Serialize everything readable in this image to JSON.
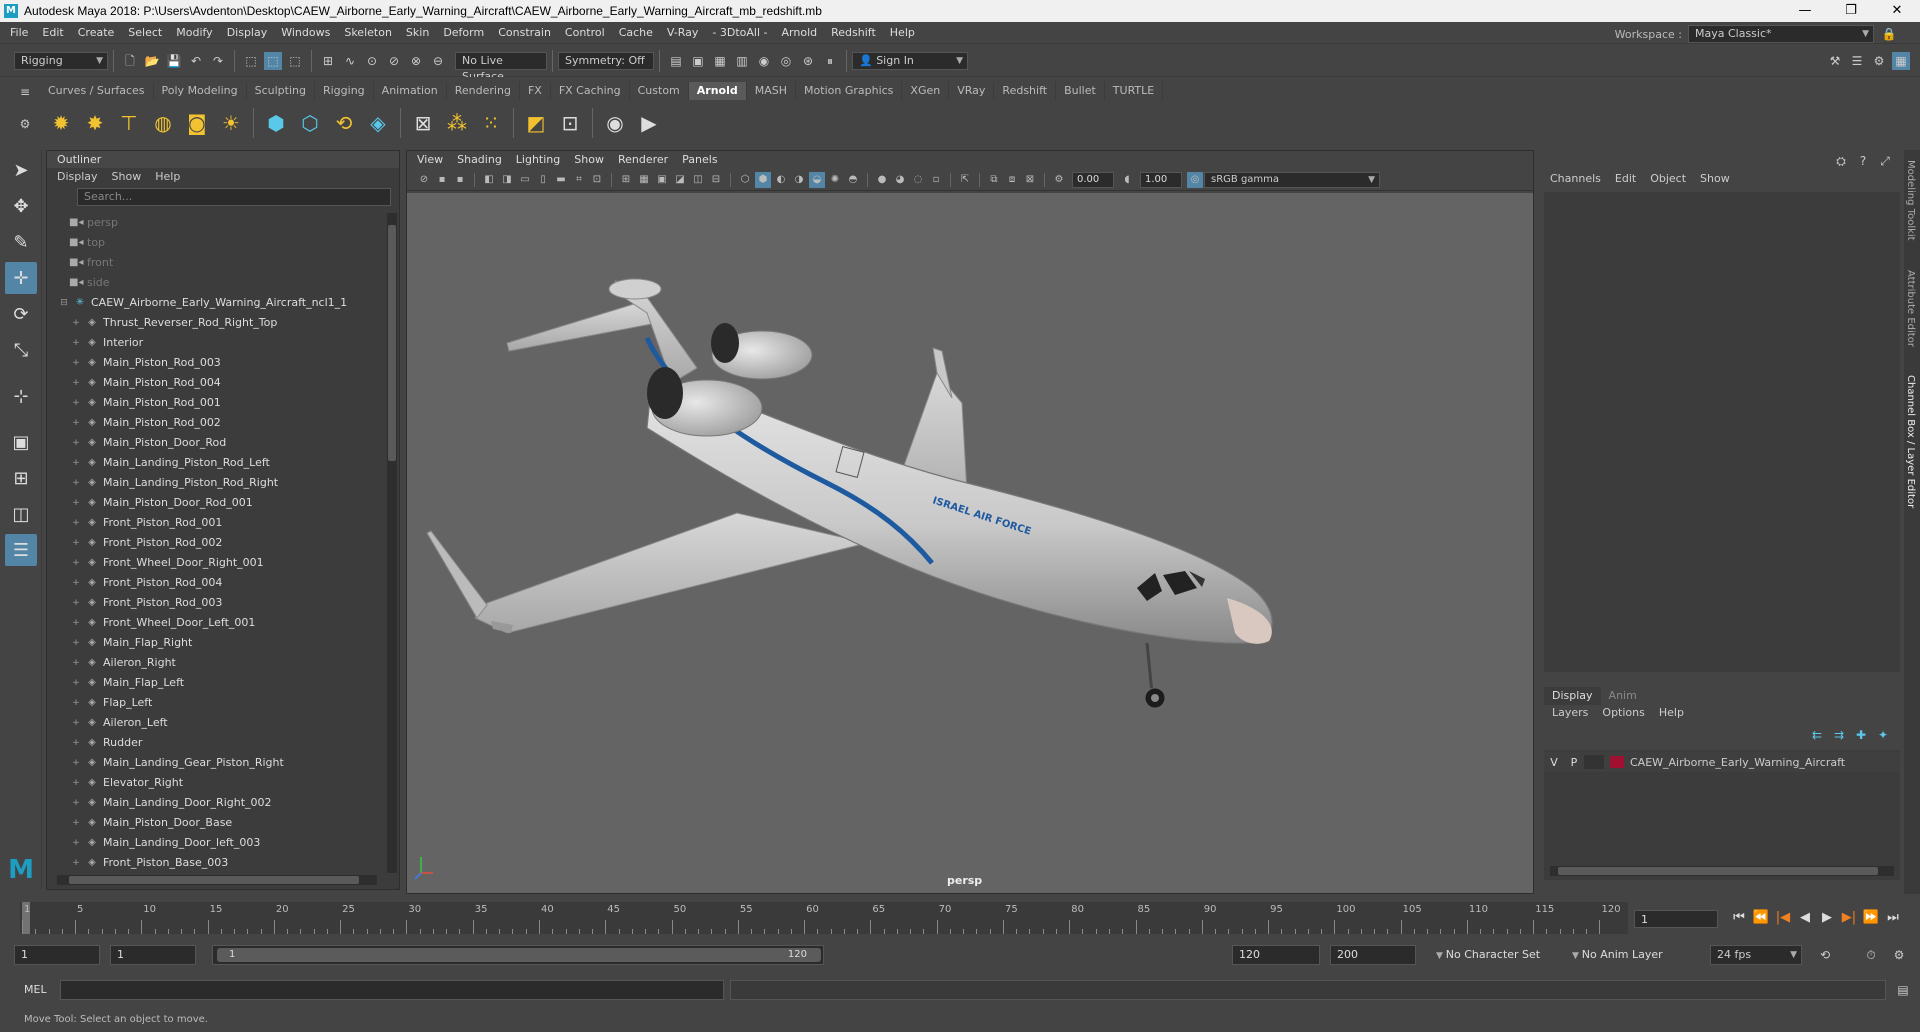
{
  "window": {
    "title": "Autodesk Maya 2018: P:\\Users\\Avdenton\\Desktop\\CAEW_Airborne_Early_Warning_Aircraft\\CAEW_Airborne_Early_Warning_Aircraft_mb_redshift.mb",
    "app_icon": "M",
    "minimize": "—",
    "maximize": "❐",
    "close": "✕"
  },
  "menubar": {
    "items": [
      "File",
      "Edit",
      "Create",
      "Select",
      "Modify",
      "Display",
      "Windows",
      "Skeleton",
      "Skin",
      "Deform",
      "Constrain",
      "Control",
      "Cache",
      "V-Ray",
      "- 3DtoAll -",
      "Arnold",
      "Redshift",
      "Help"
    ],
    "workspace_label": "Workspace :",
    "workspace_value": "Maya Classic*"
  },
  "statusline": {
    "mode": "Rigging",
    "live_surface": "No Live Surface",
    "symmetry": "Symmetry: Off",
    "sign_in": "Sign In"
  },
  "shelf": {
    "tabs": [
      "Curves / Surfaces",
      "Poly Modeling",
      "Sculpting",
      "Rigging",
      "Animation",
      "Rendering",
      "FX",
      "FX Caching",
      "Custom",
      "Arnold",
      "MASH",
      "Motion Graphics",
      "XGen",
      "VRay",
      "Redshift",
      "Bullet",
      "TURTLE"
    ],
    "active_tab": "Arnold"
  },
  "outliner": {
    "title": "Outliner",
    "menus": [
      "Display",
      "Show",
      "Help"
    ],
    "search_placeholder": "Search...",
    "cameras": [
      "persp",
      "top",
      "front",
      "side"
    ],
    "root": "CAEW_Airborne_Early_Warning_Aircraft_ncl1_1",
    "items": [
      "Thrust_Reverser_Rod_Right_Top",
      "Interior",
      "Main_Piston_Rod_003",
      "Main_Piston_Rod_004",
      "Main_Piston_Rod_001",
      "Main_Piston_Rod_002",
      "Main_Piston_Door_Rod",
      "Main_Landing_Piston_Rod_Left",
      "Main_Landing_Piston_Rod_Right",
      "Main_Piston_Door_Rod_001",
      "Front_Piston_Rod_001",
      "Front_Piston_Rod_002",
      "Front_Wheel_Door_Right_001",
      "Front_Piston_Rod_004",
      "Front_Piston_Rod_003",
      "Front_Wheel_Door_Left_001",
      "Main_Flap_Right",
      "Aileron_Right",
      "Main_Flap_Left",
      "Flap_Left",
      "Aileron_Left",
      "Rudder",
      "Main_Landing_Gear_Piston_Right",
      "Elevator_Right",
      "Main_Landing_Door_Right_002",
      "Main_Piston_Door_Base",
      "Main_Landing_Door_left_003",
      "Front_Piston_Base_003"
    ]
  },
  "viewport": {
    "menus": [
      "View",
      "Shading",
      "Lighting",
      "Show",
      "Renderer",
      "Panels"
    ],
    "exposure": "0.00",
    "gamma": "1.00",
    "color_space": "sRGB gamma",
    "camera_label": "persp",
    "aircraft_text": "ISRAEL AIR FORCE"
  },
  "channelbox": {
    "menus": [
      "Channels",
      "Edit",
      "Object",
      "Show"
    ],
    "layer_tabs": [
      "Display",
      "Anim"
    ],
    "active_layer_tab": "Display",
    "layer_menus": [
      "Layers",
      "Options",
      "Help"
    ],
    "layer": {
      "v": "V",
      "p": "P",
      "name": "CAEW_Airborne_Early_Warning_Aircraft",
      "color": "#a01030"
    },
    "side_tabs": [
      "Modeling Toolkit",
      "Attribute Editor",
      "Channel Box / Layer Editor"
    ]
  },
  "timeslider": {
    "ticks": [
      1,
      5,
      10,
      15,
      20,
      25,
      30,
      35,
      40,
      45,
      50,
      55,
      60,
      65,
      70,
      75,
      80,
      85,
      90,
      95,
      100,
      105,
      110,
      115,
      120
    ],
    "current_frame": "1"
  },
  "range": {
    "start": "1",
    "playback_start": "1",
    "range_start": "1",
    "range_end": "120",
    "playback_end": "120",
    "end": "200",
    "character_set": "No Character Set",
    "anim_layer": "No Anim Layer",
    "fps": "24 fps"
  },
  "cmdline": {
    "lang": "MEL"
  },
  "helpline": {
    "text": "Move Tool: Select an object to move."
  }
}
